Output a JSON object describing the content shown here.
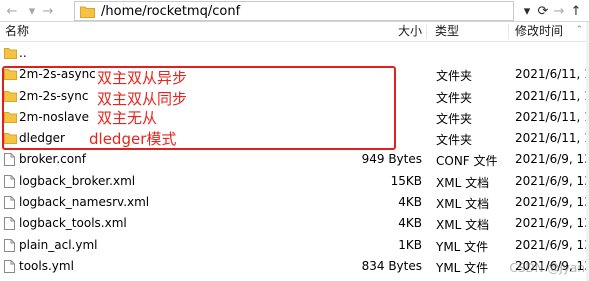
{
  "address_bar": {
    "path": "/home/rocketmq/conf"
  },
  "columns": {
    "name": "名称",
    "size": "大小",
    "type": "类型",
    "modified": "修改时间"
  },
  "rows": [
    {
      "name": "..",
      "size": "",
      "type": "",
      "modified": "",
      "icon": "folder-icon"
    },
    {
      "name": "2m-2s-async",
      "size": "",
      "type": "文件夹",
      "modified": "2021/6/11, 1(",
      "icon": "folder-icon"
    },
    {
      "name": "2m-2s-sync",
      "size": "",
      "type": "文件夹",
      "modified": "2021/6/11, 1(",
      "icon": "folder-icon"
    },
    {
      "name": "2m-noslave",
      "size": "",
      "type": "文件夹",
      "modified": "2021/6/11, 1(",
      "icon": "folder-icon"
    },
    {
      "name": "dledger",
      "size": "",
      "type": "文件夹",
      "modified": "2021/6/11, 1(",
      "icon": "folder-icon"
    },
    {
      "name": "broker.conf",
      "size": "949 Bytes",
      "type": "CONF 文件",
      "modified": "2021/6/9, 13",
      "icon": "file-icon"
    },
    {
      "name": "logback_broker.xml",
      "size": "15KB",
      "type": "XML 文档",
      "modified": "2021/6/9, 13",
      "icon": "file-icon"
    },
    {
      "name": "logback_namesrv.xml",
      "size": "4KB",
      "type": "XML 文档",
      "modified": "2021/6/9, 13",
      "icon": "file-icon"
    },
    {
      "name": "logback_tools.xml",
      "size": "4KB",
      "type": "XML 文档",
      "modified": "2021/6/9, 13",
      "icon": "file-icon"
    },
    {
      "name": "plain_acl.yml",
      "size": "1KB",
      "type": "YML 文件",
      "modified": "2021/6/9, 13",
      "icon": "file-icon"
    },
    {
      "name": "tools.yml",
      "size": "834 Bytes",
      "type": "YML 文件",
      "modified": "2021/6/9, 13",
      "icon": "file-icon"
    }
  ],
  "annotations": [
    "双主双从异步",
    "双主双从同步",
    "双主无从",
    "dledger模式"
  ],
  "watermark": "CSDN @Jyan",
  "colors": {
    "folder": "#f5c242",
    "annotation_red": "#e0201a"
  }
}
